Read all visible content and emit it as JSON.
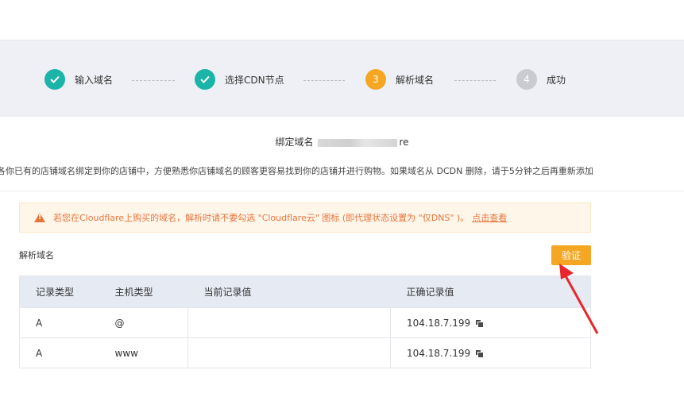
{
  "steps": [
    {
      "label": "输入域名",
      "state": "done",
      "number": ""
    },
    {
      "label": "选择CDN节点",
      "state": "done",
      "number": ""
    },
    {
      "label": "解析域名",
      "state": "active",
      "number": "3"
    },
    {
      "label": "成功",
      "state": "todo",
      "number": "4"
    }
  ],
  "bind_domain": {
    "label": "绑定域名",
    "value_suffix": "re"
  },
  "description": "各你已有的店铺域名绑定到你的店铺中，方便熟悉你店铺域名的顾客更容易找到你的店铺并进行购物。如果域名从 DCDN 删除，请于5分钟之后再重新添加",
  "warning": {
    "text": "若您在Cloudflare上购买的域名，解析时请不要勾选 \"Cloudflare云\" 图标 (即代理状态设置为 \"仅DNS\" )。",
    "link": "点击查看"
  },
  "section_title": "解析域名",
  "verify_label": "验证",
  "table": {
    "headers": [
      "记录类型",
      "主机类型",
      "当前记录值",
      "正确记录值"
    ],
    "rows": [
      [
        "A",
        "@",
        "",
        "104.18.7.199"
      ],
      [
        "A",
        "www",
        "",
        "104.18.7.199"
      ]
    ]
  },
  "colors": {
    "done": "#1cb3a8",
    "active": "#f5a623",
    "warning_text": "#e8743b",
    "annotation_arrow": "#e8262b"
  },
  "icons": {
    "done_step": "check-icon",
    "warning": "warning-icon",
    "copy": "copy-icon"
  }
}
